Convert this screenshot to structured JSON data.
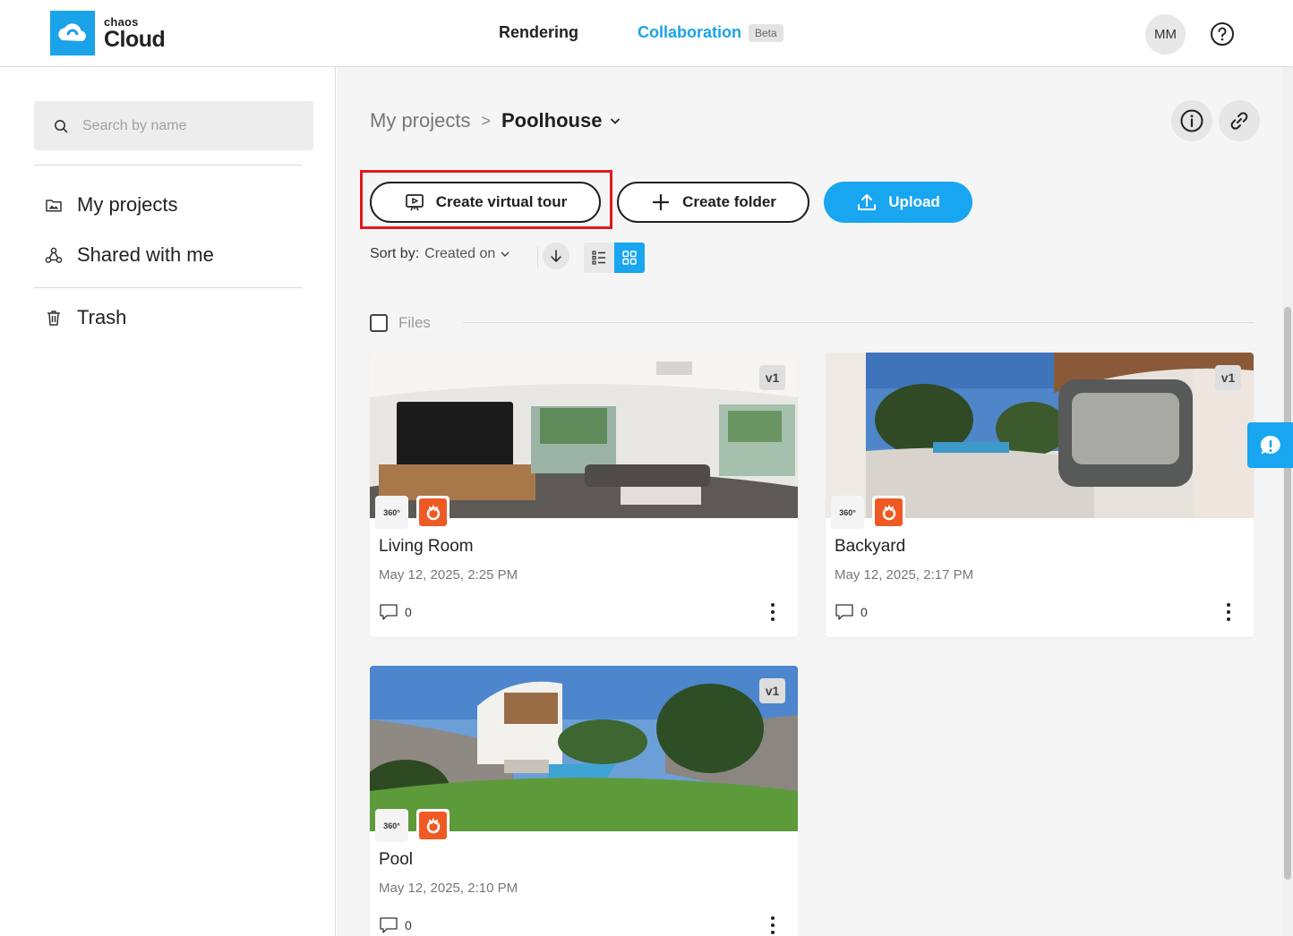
{
  "header": {
    "logo_small": "chaos",
    "logo_big": "Cloud",
    "nav_rendering": "Rendering",
    "nav_collaboration": "Collaboration",
    "beta": "Beta",
    "avatar": "MM",
    "accent_color": "#1aa3e8"
  },
  "sidebar": {
    "search_placeholder": "Search by name",
    "items": [
      {
        "label": "My projects",
        "icon": "image-folder-icon"
      },
      {
        "label": "Shared with me",
        "icon": "share-nodes-icon"
      },
      {
        "label": "Trash",
        "icon": "trash-icon"
      }
    ]
  },
  "main": {
    "breadcrumb_root": "My projects",
    "breadcrumb_sep": ">",
    "breadcrumb_current": "Poolhouse",
    "buttons": {
      "create_tour": "Create virtual tour",
      "create_folder": "Create folder",
      "upload": "Upload"
    },
    "sort_label": "Sort by:",
    "sort_value": "Created on",
    "files_label": "Files",
    "cards": [
      {
        "title": "Living Room",
        "date": "May 12, 2025, 2:25 PM",
        "comments": "0",
        "version": "v1",
        "badge": "360°"
      },
      {
        "title": "Backyard",
        "date": "May 12, 2025, 2:17 PM",
        "comments": "0",
        "version": "v1",
        "badge": "360°"
      },
      {
        "title": "Pool",
        "date": "May 12, 2025, 2:10 PM",
        "comments": "0",
        "version": "v1",
        "badge": "360°"
      }
    ]
  }
}
